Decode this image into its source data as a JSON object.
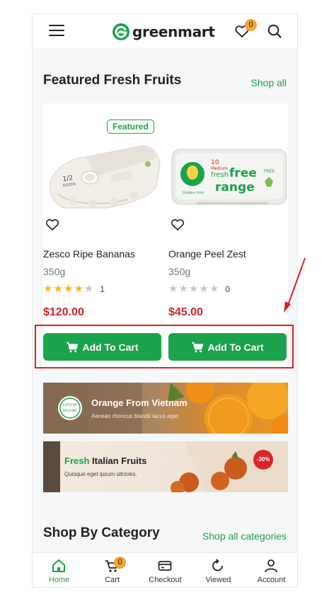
{
  "header": {
    "logo_text": "greenmart",
    "wishlist_count": "0",
    "icons": [
      "menu-icon",
      "heart-icon",
      "search-icon"
    ]
  },
  "featured_section": {
    "title": "Featured Fresh Fruits",
    "link": "Shop all"
  },
  "products": [
    {
      "tag": "Featured",
      "name": "Zesco Ripe Bananas",
      "weight": "350g",
      "rating": 4,
      "rating_count": "1",
      "price": "$120.00",
      "button": "Add To Cart",
      "image_text": [
        "1/2",
        "DOZEN"
      ]
    },
    {
      "tag": "",
      "name": "Orange Peel Zest",
      "weight": "350g",
      "rating": 0,
      "rating_count": "0",
      "price": "$45.00",
      "button": "Add To Cart",
      "image_text": [
        "10",
        "Medium",
        "fresh",
        "free",
        "range",
        "Golden Irish",
        "FREE"
      ]
    }
  ],
  "banners": [
    {
      "title": "Orange From Vietnam",
      "subtitle": "Aenean rhoncus blandit lacus eget.",
      "seal_text": [
        "CERTIFIED",
        "ORGANIC"
      ]
    },
    {
      "title_accent": "Fresh",
      "title": "Italian Fruits",
      "subtitle": "Quisque eget ipsum ultricies.",
      "discount": "-30%"
    }
  ],
  "category_section": {
    "title": "Shop By Category",
    "link": "Shop all categories"
  },
  "bottom_nav": [
    {
      "label": "Home",
      "icon": "home-icon",
      "active": true
    },
    {
      "label": "Cart",
      "icon": "cart-icon",
      "badge": "0"
    },
    {
      "label": "Checkout",
      "icon": "card-icon"
    },
    {
      "label": "Viewed",
      "icon": "refresh-icon"
    },
    {
      "label": "Account",
      "icon": "user-icon"
    }
  ],
  "colors": {
    "accent": "#1aa34a",
    "price": "#c9252b",
    "badge": "#f4a52c",
    "star": "#f5b614",
    "annotation": "#e02020"
  }
}
